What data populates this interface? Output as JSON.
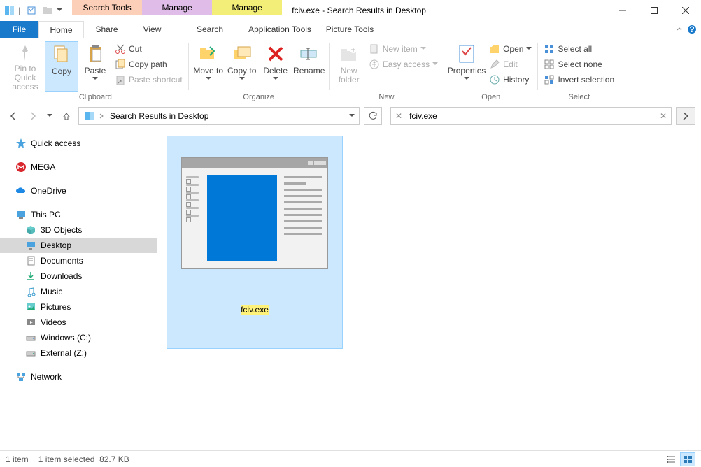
{
  "window": {
    "title": "fciv.exe - Search Results in Desktop"
  },
  "context_tabs": [
    {
      "label": "Search Tools",
      "sub": "Search",
      "bg": "#fccfb8"
    },
    {
      "label": "Manage",
      "sub": "Application Tools",
      "bg": "#e0bce8"
    },
    {
      "label": "Manage",
      "sub": "Picture Tools",
      "bg": "#f2ee77"
    }
  ],
  "file_tab": "File",
  "main_tabs": [
    "Home",
    "Share",
    "View"
  ],
  "ribbon": {
    "pin": "Pin to Quick access",
    "copy": "Copy",
    "paste": "Paste",
    "cut": "Cut",
    "copy_path": "Copy path",
    "paste_shortcut": "Paste shortcut",
    "clipboard": "Clipboard",
    "move_to": "Move to",
    "copy_to": "Copy to",
    "delete": "Delete",
    "rename": "Rename",
    "organize": "Organize",
    "new_folder": "New folder",
    "new_item": "New item",
    "easy_access": "Easy access",
    "new": "New",
    "properties": "Properties",
    "open": "Open",
    "edit": "Edit",
    "history": "History",
    "open_group": "Open",
    "select_all": "Select all",
    "select_none": "Select none",
    "invert": "Invert selection",
    "select": "Select"
  },
  "address": {
    "location": "Search Results in Desktop"
  },
  "search": {
    "value": "fciv.exe"
  },
  "nav": {
    "quick_access": "Quick access",
    "mega": "MEGA",
    "onedrive": "OneDrive",
    "this_pc": "This PC",
    "objects3d": "3D Objects",
    "desktop": "Desktop",
    "documents": "Documents",
    "downloads": "Downloads",
    "music": "Music",
    "pictures": "Pictures",
    "videos": "Videos",
    "windows_c": "Windows (C:)",
    "external_z": "External (Z:)",
    "network": "Network"
  },
  "result": {
    "name": "fciv.exe"
  },
  "status": {
    "count": "1 item",
    "selected": "1 item selected",
    "size": "82.7 KB"
  }
}
